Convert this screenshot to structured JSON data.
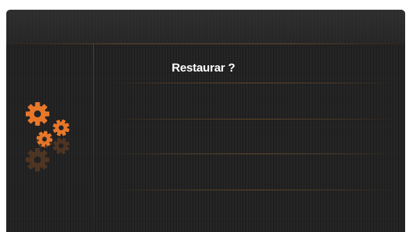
{
  "dialog": {
    "title": "Restaurar ?"
  },
  "icons": {
    "settings": "gears-icon"
  },
  "colors": {
    "accent": "#e8772a",
    "background": "#232323",
    "title": "#ffffff"
  }
}
